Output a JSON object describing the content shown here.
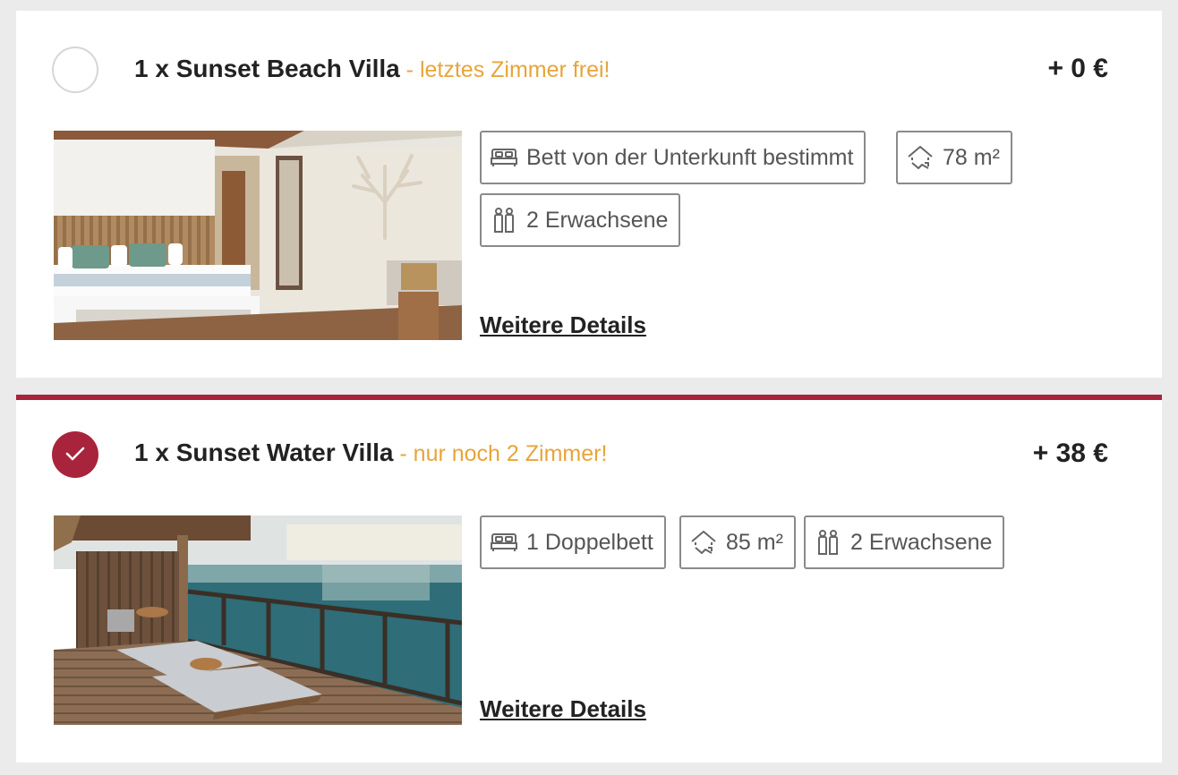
{
  "rooms": [
    {
      "selected": false,
      "name": "1 x Sunset Beach Villa",
      "availability": " - letztes Zimmer frei!",
      "price": "+ 0 €",
      "features": {
        "bed": "Bett von der Unterkunft bestimmt",
        "size": "78 m²",
        "guests": "2 Erwachsene"
      },
      "details_link": "Weitere Details",
      "image_subject": "villa-bedroom-photo"
    },
    {
      "selected": true,
      "name": "1 x Sunset Water Villa",
      "availability": " - nur noch 2 Zimmer!",
      "price": "+ 38 €",
      "features": {
        "bed": "1 Doppelbett",
        "size": "85 m²",
        "guests": "2 Erwachsene"
      },
      "details_link": "Weitere Details",
      "image_subject": "water-villa-deck-photo"
    }
  ],
  "colors": {
    "accent": "#a8243c",
    "availability": "#e8a43a",
    "chip_border": "#8a8a8a",
    "page_bg": "#ebebeb"
  },
  "icons": [
    "bed-icon",
    "area-icon",
    "guests-icon",
    "check-icon"
  ]
}
